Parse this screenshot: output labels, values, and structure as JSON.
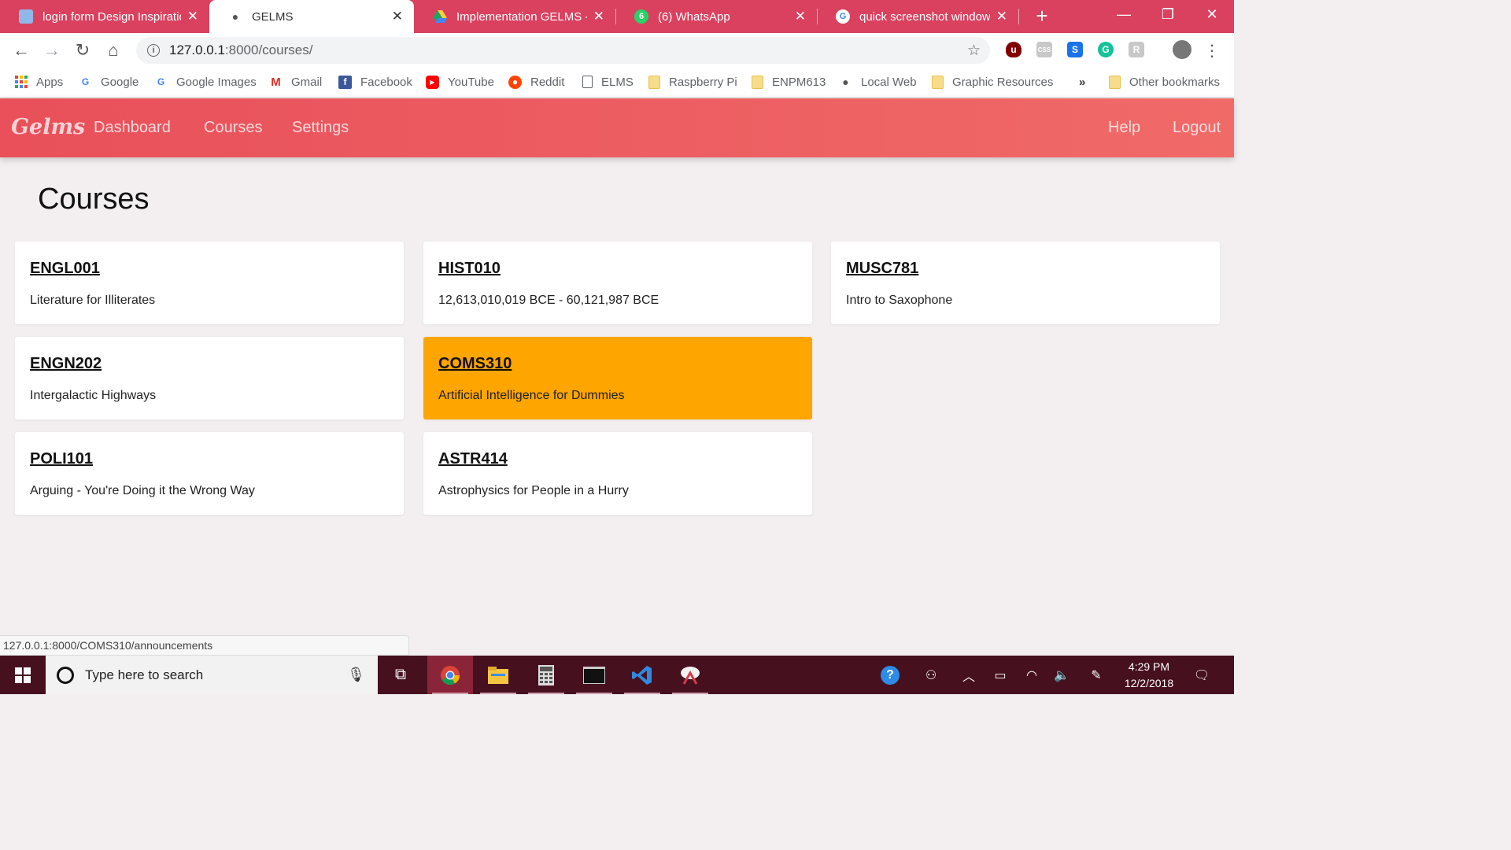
{
  "browser": {
    "tabs": [
      {
        "title": "login form Design Inspiratio",
        "active": false
      },
      {
        "title": "GELMS",
        "active": true
      },
      {
        "title": "Implementation GELMS - G",
        "active": false
      },
      {
        "title": "(6) WhatsApp",
        "active": false
      },
      {
        "title": "quick screenshot windows",
        "active": false
      }
    ],
    "address": {
      "host": "127.0.0.1",
      "path": ":8000/courses/"
    },
    "bookmarks": [
      "Apps",
      "Google",
      "Google Images",
      "Gmail",
      "Facebook",
      "YouTube",
      "Reddit",
      "ELMS",
      "Raspberry Pi",
      "ENPM613",
      "Local Web",
      "Graphic Resources"
    ],
    "overflow": "»",
    "other_bookmarks": "Other bookmarks",
    "status_url": "127.0.0.1:8000/COMS310/announcements"
  },
  "app": {
    "brand": "Gelms",
    "nav": {
      "dashboard": "Dashboard",
      "courses": "Courses",
      "settings": "Settings",
      "help": "Help",
      "logout": "Logout"
    },
    "page_title": "Courses",
    "accent": "#ffa500",
    "courses": [
      {
        "code": "ENGL001",
        "name": "Literature for Illiterates"
      },
      {
        "code": "HIST010",
        "name": "12,613,010,019 BCE - 60,121,987 BCE"
      },
      {
        "code": "MUSC781",
        "name": "Intro to Saxophone"
      },
      {
        "code": "ENGN202",
        "name": "Intergalactic Highways"
      },
      {
        "code": "COMS310",
        "name": "Artificial Intelligence for Dummies",
        "highlighted": true
      },
      {
        "code": "POLI101",
        "name": "Arguing - You're Doing it the Wrong Way"
      },
      {
        "code": "ASTR414",
        "name": "Astrophysics for People in a Hurry"
      }
    ]
  },
  "taskbar": {
    "search_placeholder": "Type here to search",
    "time": "4:29 PM",
    "date": "12/2/2018"
  }
}
